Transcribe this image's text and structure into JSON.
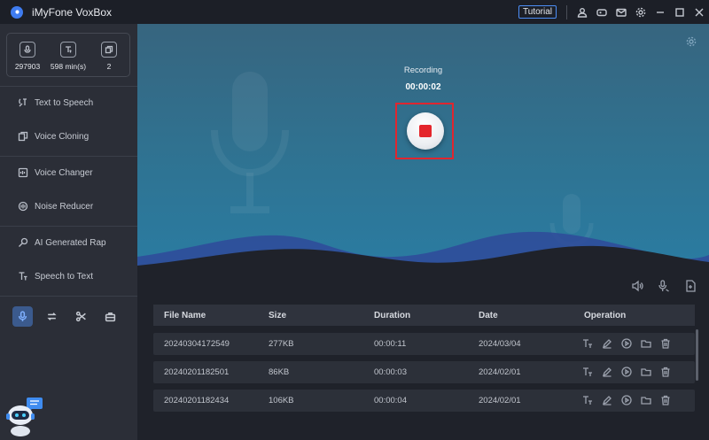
{
  "app": {
    "title": "iMyFone VoxBox"
  },
  "titlebar": {
    "tutorial_label": "Tutorial",
    "icons": [
      "user-icon",
      "gamepad-icon",
      "mail-icon",
      "settings-icon",
      "minimize-icon",
      "maximize-icon",
      "close-icon"
    ]
  },
  "stats": [
    {
      "icon": "mic-badge-icon",
      "value": "297903"
    },
    {
      "icon": "text-tool-icon",
      "value": "598 min(s)"
    },
    {
      "icon": "copy-icon",
      "value": "2"
    }
  ],
  "sidebar": {
    "items": [
      {
        "label": "Text to Speech",
        "icon": "text-to-speech-icon"
      },
      {
        "label": "Voice Cloning",
        "icon": "voice-cloning-icon"
      },
      {
        "label": "Voice Changer",
        "icon": "voice-changer-icon"
      },
      {
        "label": "Noise Reducer",
        "icon": "noise-reducer-icon"
      },
      {
        "label": "AI Generated Rap",
        "icon": "ai-rap-icon"
      },
      {
        "label": "Speech to Text",
        "icon": "speech-to-text-icon"
      }
    ],
    "tools": [
      "mic-icon",
      "repeat-icon",
      "scissors-icon",
      "toolbox-icon"
    ]
  },
  "recorder": {
    "status_label": "Recording",
    "elapsed": "00:00:02",
    "accent_color": "#e4262c"
  },
  "table": {
    "headers": [
      "File Name",
      "Size",
      "Duration",
      "Date",
      "Operation"
    ],
    "rows": [
      {
        "file_name": "20240304172549",
        "size": "277KB",
        "duration": "00:00:11",
        "date": "2024/03/04"
      },
      {
        "file_name": "20240201182501",
        "size": "86KB",
        "duration": "00:00:03",
        "date": "2024/02/01"
      },
      {
        "file_name": "20240201182434",
        "size": "106KB",
        "duration": "00:00:04",
        "date": "2024/02/01"
      }
    ],
    "operations": [
      "text-convert-icon",
      "edit-icon",
      "play-icon",
      "folder-icon",
      "delete-icon"
    ]
  },
  "colors": {
    "accent_blue": "#3f7cf0",
    "highlight_red": "#e0262f"
  }
}
